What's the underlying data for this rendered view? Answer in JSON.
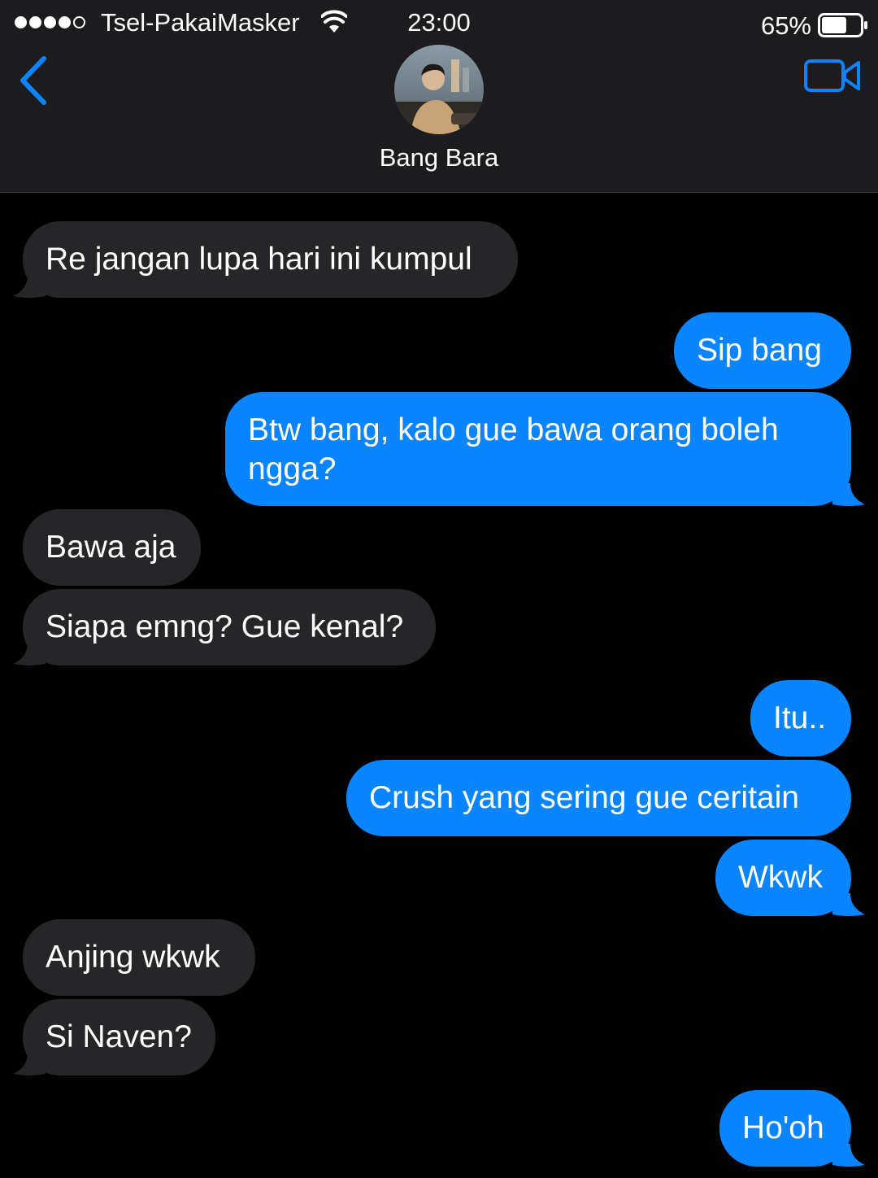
{
  "status_bar": {
    "carrier": "Tsel-PakaiMasker",
    "time": "23:00",
    "battery_percent": "65%",
    "battery_level": 0.65,
    "signal_bars": 4,
    "signal_total": 5
  },
  "header": {
    "contact_name": "Bang Bara",
    "back_icon": "chevron-left-icon",
    "video_icon": "video-camera-icon"
  },
  "colors": {
    "accent": "#0a84ff",
    "incoming_bubble": "#262628",
    "outgoing_bubble": "#0a84ff",
    "background": "#000000",
    "header_background": "#1c1c1e"
  },
  "messages": [
    {
      "direction": "in",
      "text": "Re jangan lupa hari ini kumpul"
    },
    {
      "direction": "out",
      "text": "Sip bang"
    },
    {
      "direction": "out",
      "text": "Btw bang, kalo gue bawa orang boleh ngga?"
    },
    {
      "direction": "in",
      "text": "Bawa aja"
    },
    {
      "direction": "in",
      "text": "Siapa emng? Gue kenal?"
    },
    {
      "direction": "out",
      "text": "Itu.."
    },
    {
      "direction": "out",
      "text": "Crush yang sering gue ceritain"
    },
    {
      "direction": "out",
      "text": "Wkwk"
    },
    {
      "direction": "in",
      "text": "Anjing wkwk"
    },
    {
      "direction": "in",
      "text": "Si Naven?"
    },
    {
      "direction": "out",
      "text": "Ho'oh"
    }
  ]
}
